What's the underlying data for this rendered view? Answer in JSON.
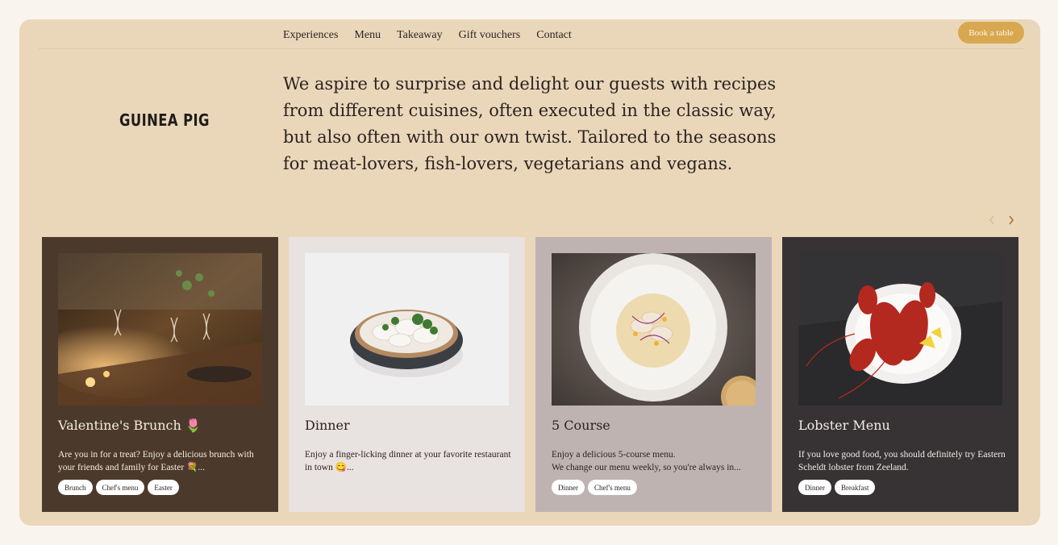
{
  "nav": {
    "items": [
      "Experiences",
      "Menu",
      "Takeaway",
      "Gift vouchers",
      "Contact"
    ],
    "book_label": "Book a table"
  },
  "brand": {
    "logo_text": "GUINEA PIG"
  },
  "intro": {
    "text": "We aspire to surprise and delight our guests with recipes from different cuisines, often executed in the classic way, but also often with our own twist. Tailored to the seasons for meat-lovers, fish-lovers, vegetarians and vegans."
  },
  "carousel": {
    "prev_icon": "chevron-left-icon",
    "next_icon": "chevron-right-icon",
    "cards": [
      {
        "title": "Valentine's Brunch 🌷",
        "description": "Are you in for a treat? Enjoy a delicious brunch with your friends and family for Easter 💐...",
        "tags": [
          "Brunch",
          "Chef's menu",
          "Easter"
        ],
        "image": "brunch-table-photo",
        "bg": "#4b3a2c"
      },
      {
        "title": "Dinner",
        "description": "Enjoy a finger-licking dinner at your favorite restaurant in town 😋...",
        "tags": [],
        "image": "dumplings-bowl-photo",
        "bg": "#e8e2e0"
      },
      {
        "title": "5 Course",
        "description": "Enjoy a delicious 5-course menu.\nWe change our menu weekly, so you're always in...",
        "tags": [
          "Dinner",
          "Chef's menu"
        ],
        "image": "ceviche-plate-photo",
        "bg": "#bfb3b1"
      },
      {
        "title": "Lobster Menu",
        "description": "If you love good food, you should definitely try Eastern Scheldt lobster from Zeeland.",
        "tags": [
          "Dinner",
          "Breakfast"
        ],
        "image": "lobster-plate-photo",
        "bg": "#373335"
      }
    ]
  },
  "colors": {
    "page_bg": "#f9f5ee",
    "panel_bg": "#ead7ba",
    "accent": "#d8a851"
  }
}
